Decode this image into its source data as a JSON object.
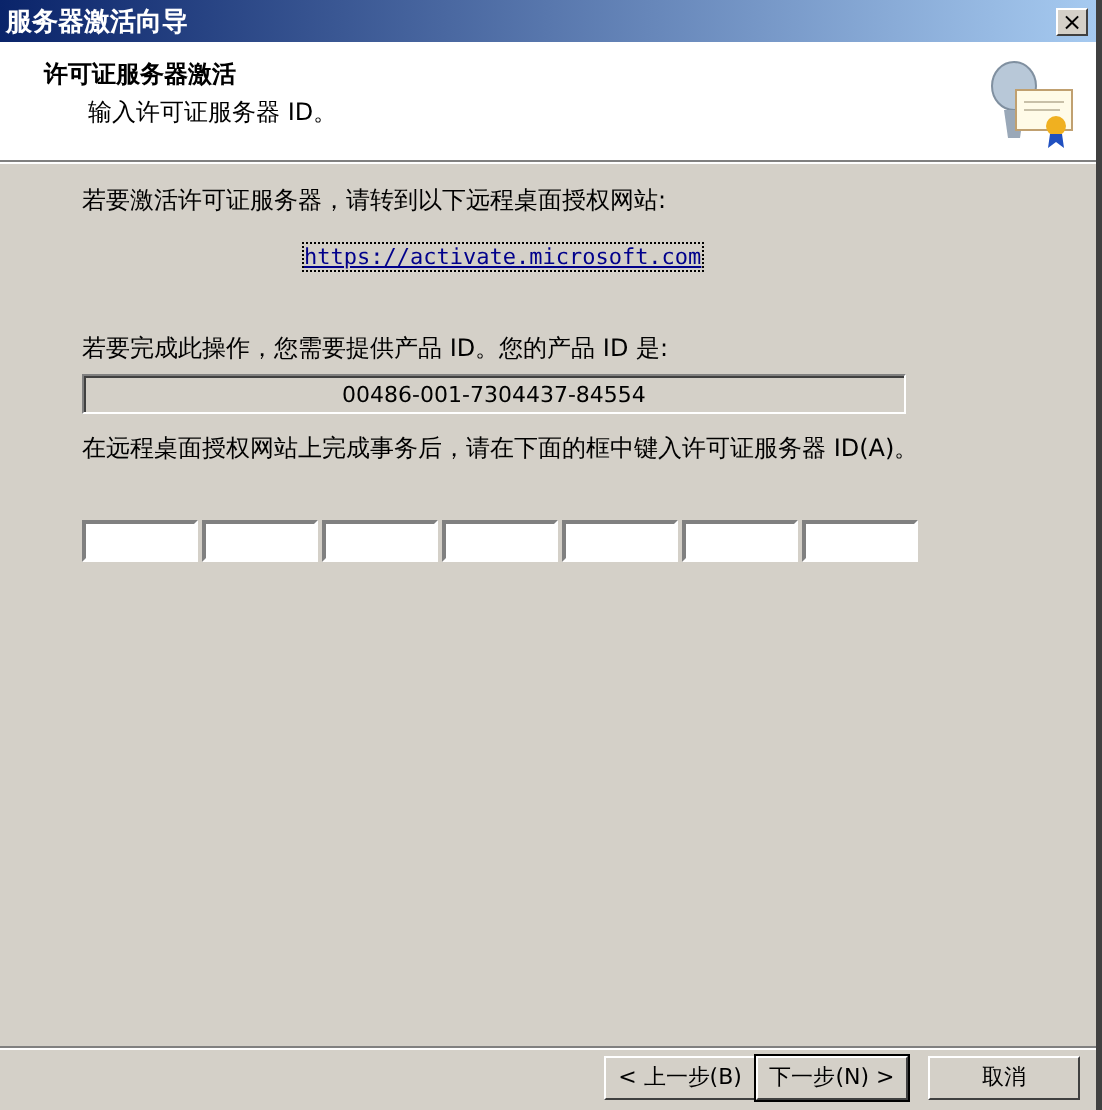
{
  "window": {
    "title": "服务器激活向导",
    "close": "×"
  },
  "header": {
    "title": "许可证服务器激活",
    "subtitle": "输入许可证服务器 ID。"
  },
  "intro": "若要激活许可证服务器，请转到以下远程桌面授权网站:",
  "link": "https://activate.microsoft.com",
  "product_prompt": "若要完成此操作，您需要提供产品 ID。您的产品 ID 是:",
  "product_id": "00486-001-7304437-84554",
  "entry_prompt": "在远程桌面授权网站上完成事务后，请在下面的框中键入许可证服务器 ID(A)。",
  "buttons": [
    {
      "label": "< 上一步(B)",
      "default": false
    },
    {
      "label": "下一步(N) >",
      "default": true
    },
    {
      "label": "取消",
      "default": false
    }
  ]
}
